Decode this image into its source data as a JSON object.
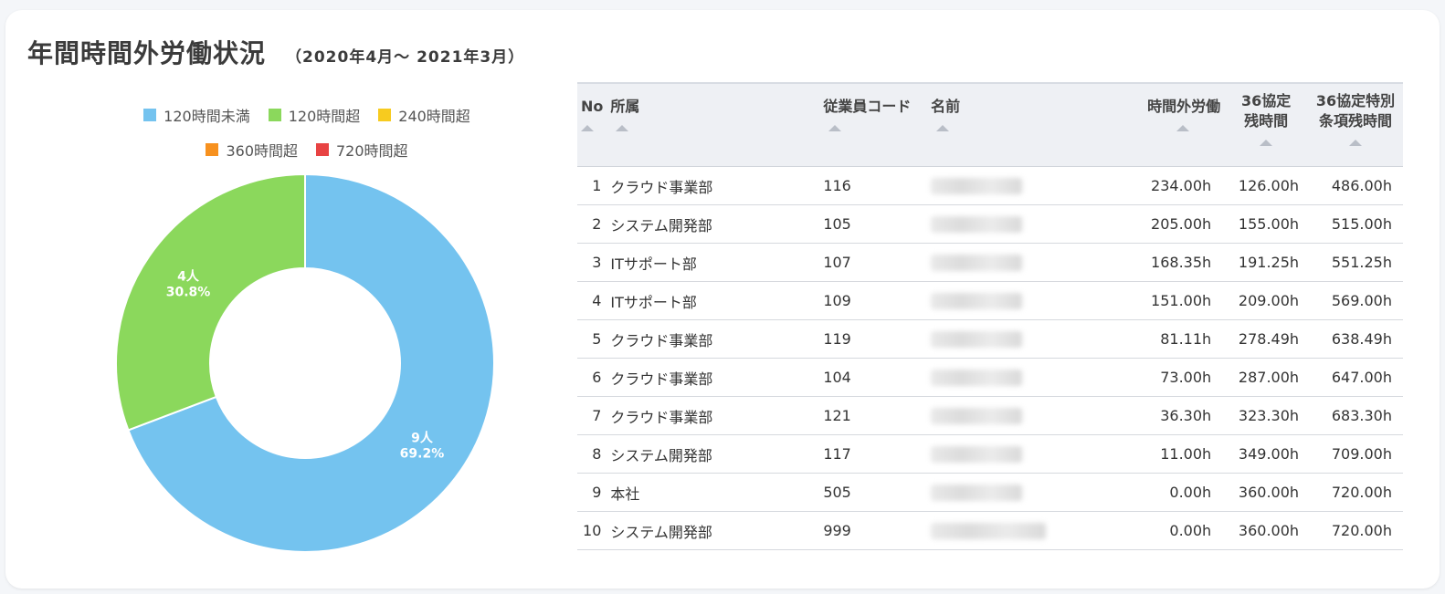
{
  "title": "年間時間外労働状況",
  "period": "（2020年4月～ 2021年3月）",
  "colors": {
    "blue": "#74c3ef",
    "green": "#8bd85c",
    "yellow": "#f7cb1f",
    "orange": "#f7911f",
    "red": "#e84343"
  },
  "chart_data": {
    "type": "pie",
    "variant": "donut",
    "legend": [
      {
        "label": "120時間未満",
        "color": "#74c3ef"
      },
      {
        "label": "120時間超",
        "color": "#8bd85c"
      },
      {
        "label": "240時間超",
        "color": "#f7cb1f"
      },
      {
        "label": "360時間超",
        "color": "#f7911f"
      },
      {
        "label": "720時間超",
        "color": "#e84343"
      }
    ],
    "legend_placement": "top",
    "slices": [
      {
        "name": "120時間未満",
        "value": 9,
        "count_label": "9人",
        "pct_label": "69.2%",
        "color": "#74c3ef"
      },
      {
        "name": "120時間超",
        "value": 4,
        "count_label": "4人",
        "pct_label": "30.8%",
        "color": "#8bd85c"
      },
      {
        "name": "240時間超",
        "value": 0,
        "count_label": "",
        "pct_label": "",
        "color": "#f7cb1f"
      },
      {
        "name": "360時間超",
        "value": 0,
        "count_label": "",
        "pct_label": "",
        "color": "#f7911f"
      },
      {
        "name": "720時間超",
        "value": 0,
        "count_label": "",
        "pct_label": "",
        "color": "#e84343"
      }
    ]
  },
  "table": {
    "headers": {
      "no": "No",
      "dept": "所属",
      "code": "従業員コード",
      "name": "名前",
      "overtime": "時間外労働",
      "remaining_1": "36協定",
      "remaining_2": "残時間",
      "special_1": "36協定特別",
      "special_2": "条項残時間"
    },
    "rows": [
      {
        "no": "1",
        "dept": "クラウド事業部",
        "code": "116",
        "overtime": "234.00h",
        "remaining": "126.00h",
        "special": "486.00h"
      },
      {
        "no": "2",
        "dept": "システム開発部",
        "code": "105",
        "overtime": "205.00h",
        "remaining": "155.00h",
        "special": "515.00h"
      },
      {
        "no": "3",
        "dept": "ITサポート部",
        "code": "107",
        "overtime": "168.35h",
        "remaining": "191.25h",
        "special": "551.25h"
      },
      {
        "no": "4",
        "dept": "ITサポート部",
        "code": "109",
        "overtime": "151.00h",
        "remaining": "209.00h",
        "special": "569.00h"
      },
      {
        "no": "5",
        "dept": "クラウド事業部",
        "code": "119",
        "overtime": "81.11h",
        "remaining": "278.49h",
        "special": "638.49h"
      },
      {
        "no": "6",
        "dept": "クラウド事業部",
        "code": "104",
        "overtime": "73.00h",
        "remaining": "287.00h",
        "special": "647.00h"
      },
      {
        "no": "7",
        "dept": "クラウド事業部",
        "code": "121",
        "overtime": "36.30h",
        "remaining": "323.30h",
        "special": "683.30h"
      },
      {
        "no": "8",
        "dept": "システム開発部",
        "code": "117",
        "overtime": "11.00h",
        "remaining": "349.00h",
        "special": "709.00h"
      },
      {
        "no": "9",
        "dept": "本社",
        "code": "505",
        "overtime": "0.00h",
        "remaining": "360.00h",
        "special": "720.00h"
      },
      {
        "no": "10",
        "dept": "システム開発部",
        "code": "999",
        "overtime": "0.00h",
        "remaining": "360.00h",
        "special": "720.00h"
      }
    ]
  }
}
